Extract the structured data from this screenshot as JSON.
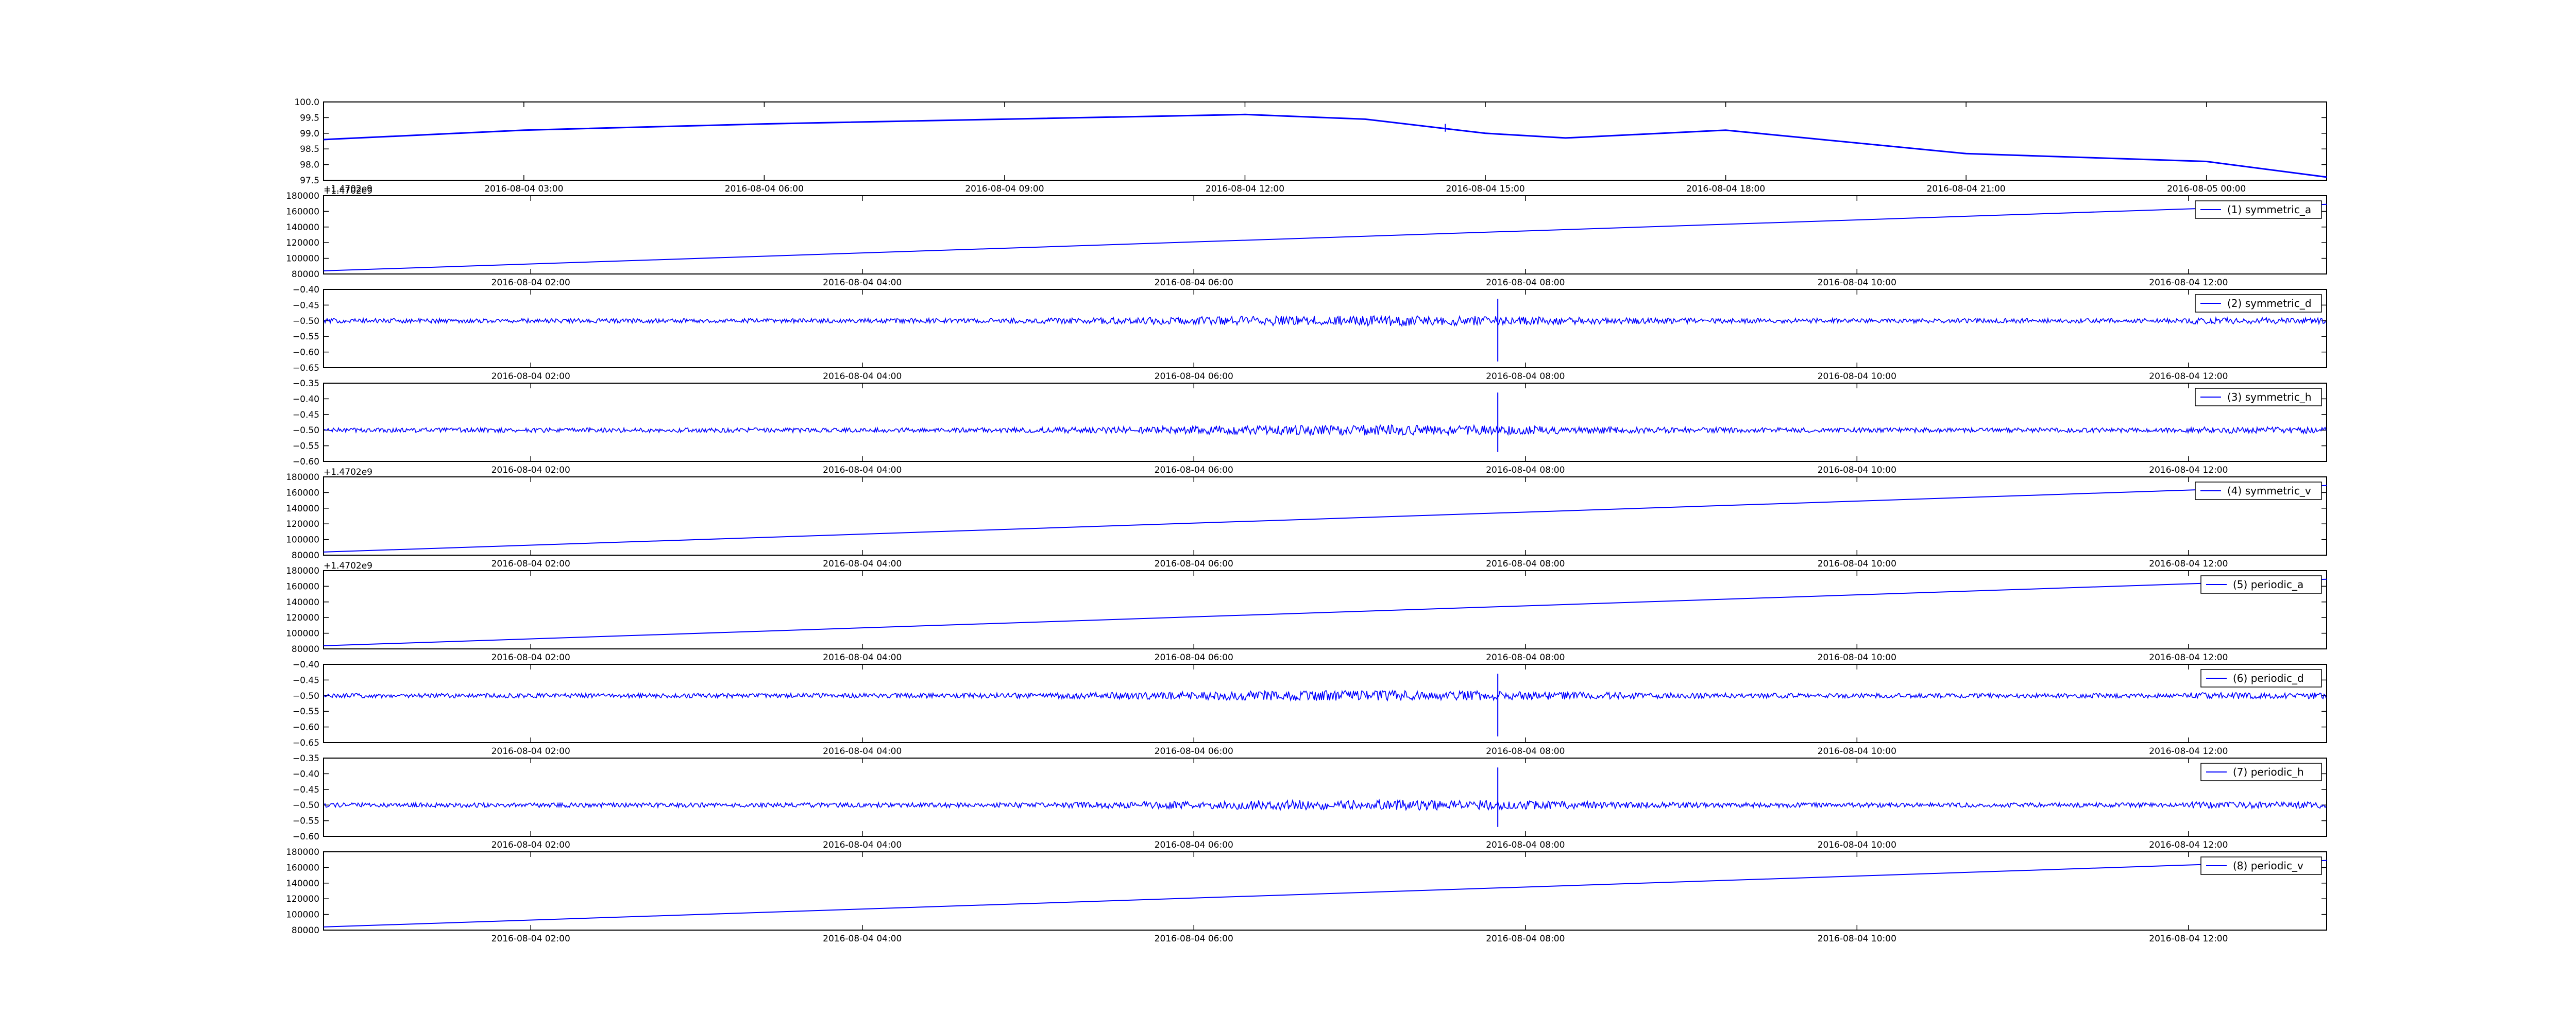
{
  "figure": {
    "background": "#ffffff",
    "line_color": "#0000ff",
    "axis_color": "#000000",
    "offset_label": "+1.4702e9"
  },
  "chart_data": [
    {
      "type": "line",
      "ylim": [
        97.5,
        100.0
      ],
      "yticks": [
        "100.0",
        "99.5",
        "99.0",
        "98.5",
        "98.0",
        "97.5"
      ],
      "xlim": [
        "2016-08-04 00:30",
        "2016-08-05 01:30"
      ],
      "xticks": [
        "2016-08-04 03:00",
        "2016-08-04 06:00",
        "2016-08-04 09:00",
        "2016-08-04 12:00",
        "2016-08-04 15:00",
        "2016-08-04 18:00",
        "2016-08-04 21:00",
        "2016-08-05 00:00"
      ],
      "series": [
        {
          "x": [
            "2016-08-04 00:30",
            "2016-08-04 03:00",
            "2016-08-04 06:00",
            "2016-08-04 09:00",
            "2016-08-04 12:00",
            "2016-08-04 13:30",
            "2016-08-04 15:00",
            "2016-08-04 16:00",
            "2016-08-04 18:00",
            "2016-08-04 19:00",
            "2016-08-04 21:00",
            "2016-08-05 00:00",
            "2016-08-05 01:30"
          ],
          "values": [
            98.8,
            99.1,
            99.3,
            99.45,
            99.6,
            99.45,
            99.0,
            98.85,
            99.1,
            98.85,
            98.35,
            98.1,
            97.6
          ]
        }
      ]
    },
    {
      "type": "line",
      "legend": "(1) symmetric_a",
      "legend_position": "top-right",
      "y_offset_label": "+1.4702e9",
      "ylim": [
        80000,
        180000
      ],
      "yticks": [
        "180000",
        "160000",
        "140000",
        "120000",
        "100000",
        "80000"
      ],
      "xlim": [
        "2016-08-04 00:45",
        "2016-08-04 12:50"
      ],
      "xticks": [
        "2016-08-04 02:00",
        "2016-08-04 04:00",
        "2016-08-04 06:00",
        "2016-08-04 08:00",
        "2016-08-04 10:00",
        "2016-08-04 12:00"
      ],
      "series": [
        {
          "name": "(1) symmetric_a",
          "x": [
            "2016-08-04 00:45",
            "2016-08-04 12:50"
          ],
          "values": [
            84000,
            169000
          ]
        }
      ]
    },
    {
      "type": "line",
      "legend": "(2) symmetric_d",
      "legend_position": "top-right",
      "ylim": [
        -0.65,
        -0.4
      ],
      "yticks": [
        "−0.40",
        "−0.45",
        "−0.50",
        "−0.55",
        "−0.60",
        "−0.65"
      ],
      "xlim": [
        "2016-08-04 00:45",
        "2016-08-04 12:50"
      ],
      "xticks": [
        "2016-08-04 02:00",
        "2016-08-04 04:00",
        "2016-08-04 06:00",
        "2016-08-04 08:00",
        "2016-08-04 10:00",
        "2016-08-04 12:00"
      ],
      "series": [
        {
          "name": "(2) symmetric_d",
          "baseline": -0.5,
          "noise": 0.012,
          "spike_at": "2016-08-04 07:50",
          "spike_range": [
            -0.63,
            -0.43
          ]
        }
      ]
    },
    {
      "type": "line",
      "legend": "(3) symmetric_h",
      "legend_position": "top-right",
      "ylim": [
        -0.6,
        -0.35
      ],
      "yticks": [
        "−0.35",
        "−0.40",
        "−0.45",
        "−0.50",
        "−0.55",
        "−0.60"
      ],
      "xlim": [
        "2016-08-04 00:45",
        "2016-08-04 12:50"
      ],
      "xticks": [
        "2016-08-04 02:00",
        "2016-08-04 04:00",
        "2016-08-04 06:00",
        "2016-08-04 08:00",
        "2016-08-04 10:00",
        "2016-08-04 12:00"
      ],
      "series": [
        {
          "name": "(3) symmetric_h",
          "baseline": -0.5,
          "noise": 0.012,
          "spike_at": "2016-08-04 07:50",
          "spike_range": [
            -0.57,
            -0.38
          ]
        }
      ]
    },
    {
      "type": "line",
      "legend": "(4) symmetric_v",
      "legend_position": "top-right",
      "y_offset_label": "+1.4702e9",
      "ylim": [
        80000,
        180000
      ],
      "yticks": [
        "180000",
        "160000",
        "140000",
        "120000",
        "100000",
        "80000"
      ],
      "xlim": [
        "2016-08-04 00:45",
        "2016-08-04 12:50"
      ],
      "xticks": [
        "2016-08-04 02:00",
        "2016-08-04 04:00",
        "2016-08-04 06:00",
        "2016-08-04 08:00",
        "2016-08-04 10:00",
        "2016-08-04 12:00"
      ],
      "series": [
        {
          "name": "(4) symmetric_v",
          "x": [
            "2016-08-04 00:45",
            "2016-08-04 12:50"
          ],
          "values": [
            84000,
            169000
          ]
        }
      ]
    },
    {
      "type": "line",
      "legend": "(5) periodic_a",
      "legend_position": "top-right",
      "y_offset_label": "+1.4702e9",
      "ylim": [
        80000,
        180000
      ],
      "yticks": [
        "180000",
        "160000",
        "140000",
        "120000",
        "100000",
        "80000"
      ],
      "xlim": [
        "2016-08-04 00:45",
        "2016-08-04 12:50"
      ],
      "xticks": [
        "2016-08-04 02:00",
        "2016-08-04 04:00",
        "2016-08-04 06:00",
        "2016-08-04 08:00",
        "2016-08-04 10:00",
        "2016-08-04 12:00"
      ],
      "series": [
        {
          "name": "(5) periodic_a",
          "x": [
            "2016-08-04 00:45",
            "2016-08-04 12:50"
          ],
          "values": [
            84000,
            169000
          ]
        }
      ]
    },
    {
      "type": "line",
      "legend": "(6) periodic_d",
      "legend_position": "top-right",
      "ylim": [
        -0.65,
        -0.4
      ],
      "yticks": [
        "−0.40",
        "−0.45",
        "−0.50",
        "−0.55",
        "−0.60",
        "−0.65"
      ],
      "xlim": [
        "2016-08-04 00:45",
        "2016-08-04 12:50"
      ],
      "xticks": [
        "2016-08-04 02:00",
        "2016-08-04 04:00",
        "2016-08-04 06:00",
        "2016-08-04 08:00",
        "2016-08-04 10:00",
        "2016-08-04 12:00"
      ],
      "series": [
        {
          "name": "(6) periodic_d",
          "baseline": -0.5,
          "noise": 0.012,
          "spike_at": "2016-08-04 07:50",
          "spike_range": [
            -0.63,
            -0.43
          ]
        }
      ]
    },
    {
      "type": "line",
      "legend": "(7) periodic_h",
      "legend_position": "top-right",
      "ylim": [
        -0.6,
        -0.35
      ],
      "yticks": [
        "−0.35",
        "−0.40",
        "−0.45",
        "−0.50",
        "−0.55",
        "−0.60"
      ],
      "xlim": [
        "2016-08-04 00:45",
        "2016-08-04 12:50"
      ],
      "xticks": [
        "2016-08-04 02:00",
        "2016-08-04 04:00",
        "2016-08-04 06:00",
        "2016-08-04 08:00",
        "2016-08-04 10:00",
        "2016-08-04 12:00"
      ],
      "series": [
        {
          "name": "(7) periodic_h",
          "baseline": -0.5,
          "noise": 0.012,
          "spike_at": "2016-08-04 07:50",
          "spike_range": [
            -0.57,
            -0.38
          ]
        }
      ]
    },
    {
      "type": "line",
      "legend": "(8) periodic_v",
      "legend_position": "top-right",
      "ylim": [
        80000,
        180000
      ],
      "yticks": [
        "180000",
        "160000",
        "140000",
        "120000",
        "100000",
        "80000"
      ],
      "xlim": [
        "2016-08-04 00:45",
        "2016-08-04 12:50"
      ],
      "xticks": [
        "2016-08-04 02:00",
        "2016-08-04 04:00",
        "2016-08-04 06:00",
        "2016-08-04 08:00",
        "2016-08-04 10:00",
        "2016-08-04 12:00"
      ],
      "series": [
        {
          "name": "(8) periodic_v",
          "x": [
            "2016-08-04 00:45",
            "2016-08-04 12:50"
          ],
          "values": [
            84000,
            169000
          ]
        }
      ]
    }
  ]
}
